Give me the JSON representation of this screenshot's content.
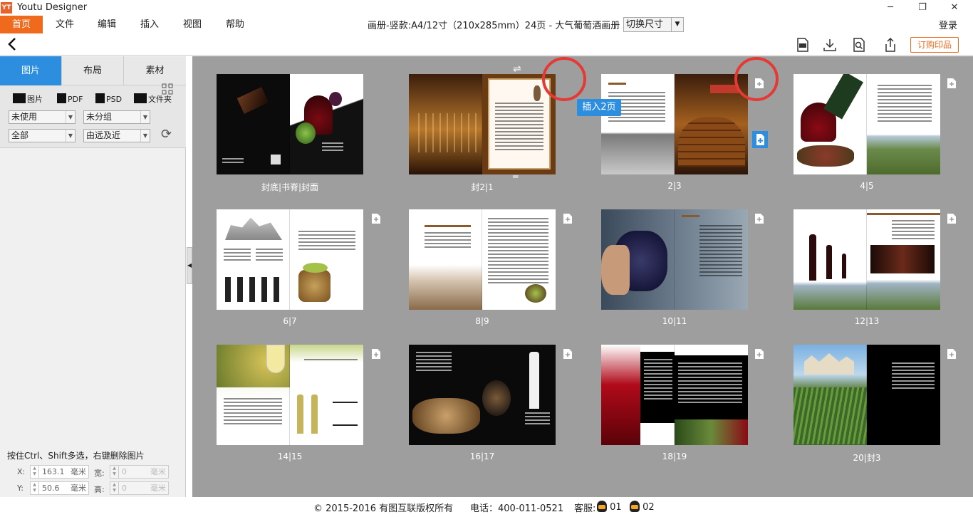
{
  "window": {
    "app_icon": "YT",
    "title": "Youtu Designer",
    "minimize": "─",
    "restore": "❐",
    "close": "✕"
  },
  "menubar": {
    "items": [
      "首页",
      "文件",
      "编辑",
      "插入",
      "视图",
      "帮助"
    ],
    "doc_title": "画册-竖款:A4/12寸（210x285mm）24页 - 大气葡萄酒画册",
    "size_select": "切换尺寸",
    "login": "登录"
  },
  "toolbar": {
    "back_icon": "chevron-left-icon",
    "icons": [
      "document-icon",
      "download-icon",
      "preview-icon",
      "share-icon"
    ],
    "order_button": "订购印品"
  },
  "sidebar": {
    "tabs": [
      "图片",
      "布局",
      "素材"
    ],
    "file_types": [
      "图片",
      "PDF",
      "PSD",
      "文件夹"
    ],
    "filter_usage": "未使用",
    "filter_group": "未分组",
    "filter_scope": "全部",
    "filter_sort": "由远及近",
    "hint": "按住Ctrl、Shift多选，右键删除图片",
    "x_label": "X:",
    "x_value": "163.1",
    "x_unit": "毫米",
    "y_label": "Y:",
    "y_value": "50.6",
    "y_unit": "毫米",
    "w_label": "宽:",
    "w_value": "0",
    "w_unit": "毫米",
    "h_label": "高:",
    "h_value": "0",
    "h_unit": "毫米"
  },
  "pages": {
    "labels": [
      "封底|书脊|封面",
      "封2|1",
      "2|3",
      "4|5",
      "6|7",
      "8|9",
      "10|11",
      "12|13",
      "14|15",
      "16|17",
      "18|19",
      "20|封3"
    ],
    "tooltip": "插入2页",
    "swap_glyph": "⇌",
    "eq_glyph": "═"
  },
  "footer": {
    "copyright": "© 2015-2016 有图互联版权所有",
    "phone": "电话：400-011-0521",
    "service": "客服:",
    "qq1": "01",
    "qq2": "02"
  },
  "colors": {
    "accent": "#f06a1e",
    "blue": "#2d8ddf",
    "canvas": "#9e9e9e",
    "highlight": "#e53935"
  }
}
